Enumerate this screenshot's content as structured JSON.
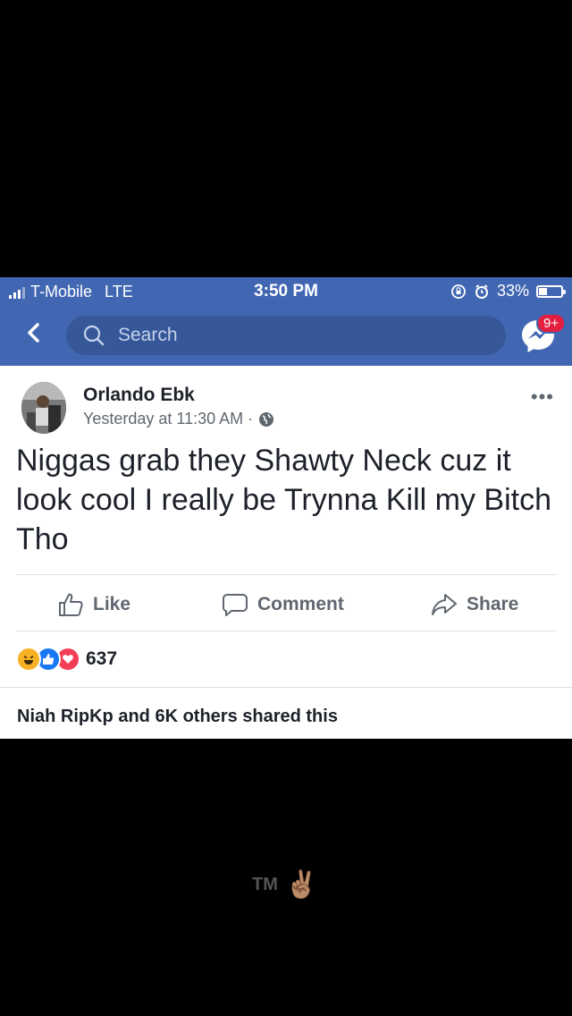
{
  "status": {
    "carrier": "T-Mobile",
    "network": "LTE",
    "time": "3:50 PM",
    "battery": "33%"
  },
  "nav": {
    "search_placeholder": "Search",
    "badge": "9+"
  },
  "post": {
    "author": "Orlando Ebk",
    "timestamp": "Yesterday at 11:30 AM ·",
    "text": "Niggas grab they Shawty Neck cuz it look cool I really be Trynna Kill my Bitch Tho",
    "actions": {
      "like": "Like",
      "comment": "Comment",
      "share": "Share"
    },
    "reaction_count": "637",
    "shared_text": "Niah RipKp and 6K others shared this"
  },
  "watermark": {
    "text": "TM",
    "emoji": "✌🏽"
  },
  "colors": {
    "header": "#4267b2",
    "search": "#365899",
    "badge": "#e41e3f"
  }
}
